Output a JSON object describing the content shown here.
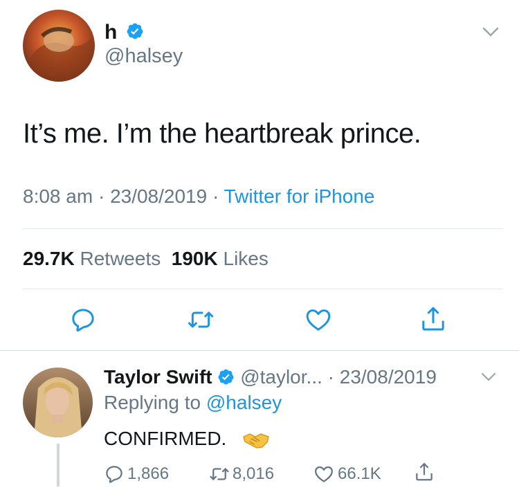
{
  "tweet": {
    "display_name": "h",
    "handle": "@halsey",
    "text": "It’s me. I’m the heartbreak prince.",
    "time": "8:08 am",
    "date": "23/08/2019",
    "source": "Twitter for iPhone",
    "retweets_count": "29.7K",
    "retweets_label": "Retweets",
    "likes_count": "190K",
    "likes_label": "Likes",
    "separator": "·"
  },
  "reply": {
    "display_name": "Taylor Swift",
    "handle": "@taylor...",
    "date": "· 23/08/2019",
    "replying_prefix": "Replying to",
    "replying_handle": "@halsey",
    "text": "CONFIRMED.",
    "emoji": "handshake-emoji",
    "reply_count": "1,866",
    "retweet_count": "8,016",
    "like_count": "66.1K"
  },
  "colors": {
    "text": "#14171a",
    "secondary": "#657786",
    "link": "#1b95e0",
    "verified": "#1da1f2",
    "divider": "#e1e8ed",
    "icon": "#1b95e0"
  },
  "icons": [
    "chevron-down-icon",
    "verified-badge-icon",
    "reply-icon",
    "retweet-icon",
    "like-icon",
    "share-icon"
  ]
}
